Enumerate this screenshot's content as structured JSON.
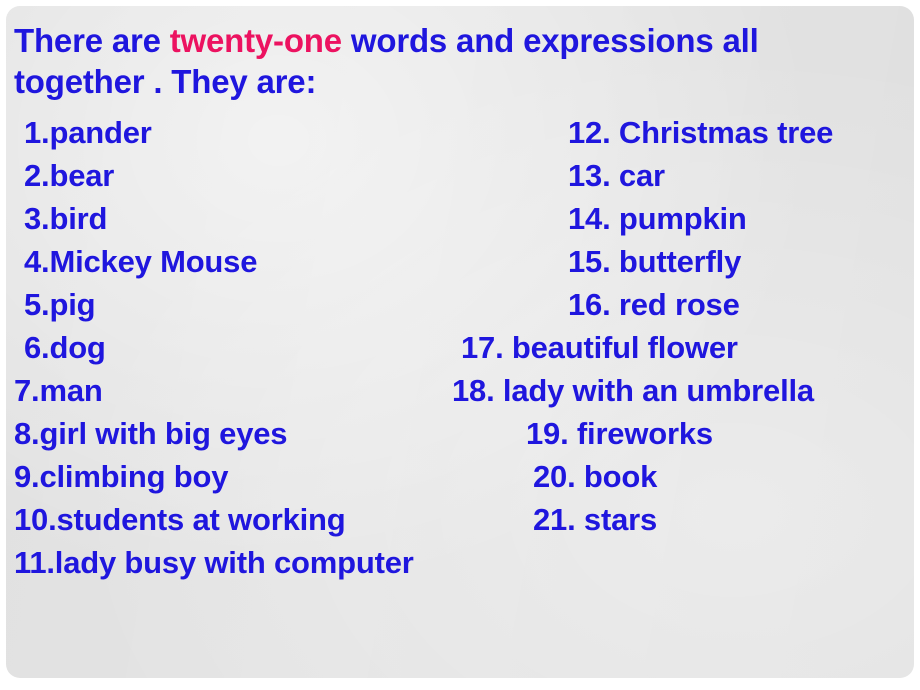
{
  "slide": {
    "background_color": "#e4e4e4",
    "text_color": "#1f16de",
    "highlight_color": "#ec1260"
  },
  "heading": {
    "part1": "There are ",
    "highlight": "twenty-one",
    "part2": " words and expressions all together . They are:"
  },
  "columns": {
    "left": [
      {
        "number": "1.",
        "label": "pander",
        "text": "1.pander"
      },
      {
        "number": "2.",
        "label": "bear",
        "text": "2.bear"
      },
      {
        "number": "3.",
        "label": "bird",
        "text": "3.bird"
      },
      {
        "number": "4.",
        "label": "Mickey Mouse",
        "text": "4.Mickey Mouse"
      },
      {
        "number": "5.",
        "label": "pig",
        "text": "5.pig"
      },
      {
        "number": "6.",
        "label": "dog",
        "text": "6.dog"
      },
      {
        "number": "7.",
        "label": "man",
        "text": "7.man"
      },
      {
        "number": "8.",
        "label": "girl with big eyes",
        "text": "8.girl with big eyes"
      },
      {
        "number": "9.",
        "label": "climbing boy",
        "text": "9.climbing boy"
      },
      {
        "number": "10.",
        "label": "students at working",
        "text": "10.students at working"
      },
      {
        "number": "11.",
        "label": "lady busy with computer",
        "text": "11.lady busy with computer"
      }
    ],
    "right": [
      {
        "number": "12.",
        "label": "Christmas tree",
        "text": "12. Christmas tree"
      },
      {
        "number": "13.",
        "label": "car",
        "text": "13. car"
      },
      {
        "number": "14.",
        "label": "pumpkin",
        "text": "14. pumpkin"
      },
      {
        "number": "15.",
        "label": "butterfly",
        "text": "15. butterfly"
      },
      {
        "number": "16.",
        "label": "red rose",
        "text": "16. red rose"
      },
      {
        "number": "17.",
        "label": "beautiful flower",
        "text": "17. beautiful flower"
      },
      {
        "number": "18.",
        "label": "lady with an umbrella",
        "text": "18. lady with an umbrella"
      },
      {
        "number": "19.",
        "label": "fireworks",
        "text": "19. fireworks"
      },
      {
        "number": "20.",
        "label": "book",
        "text": "20. book"
      },
      {
        "number": "21.",
        "label": "stars",
        "text": "21. stars"
      }
    ]
  },
  "layout": {
    "row_tops": [
      105,
      148,
      191,
      234,
      277,
      320,
      363,
      406,
      449,
      492,
      535
    ],
    "left_x": [
      18,
      18,
      18,
      18,
      18,
      18,
      8,
      8,
      8,
      8,
      8
    ],
    "right_x": [
      562,
      562,
      562,
      562,
      562,
      455,
      446,
      520,
      527,
      527
    ]
  }
}
